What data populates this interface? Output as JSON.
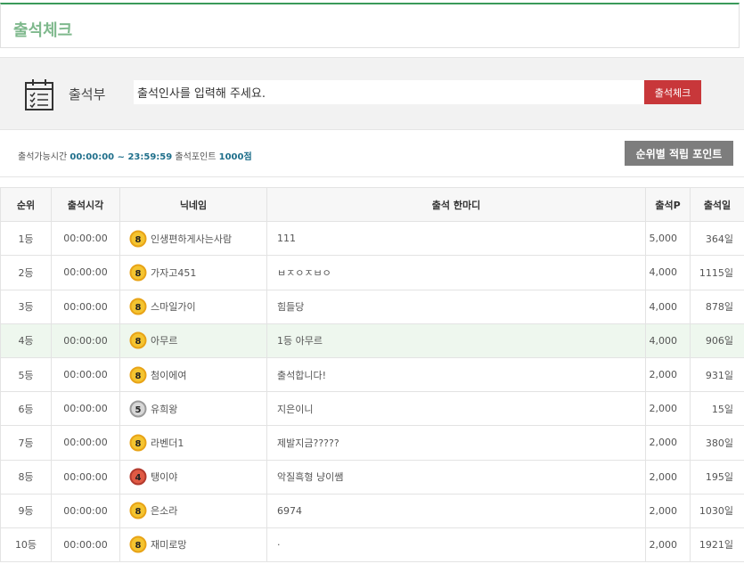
{
  "header": {
    "title": "출석체크"
  },
  "checkin": {
    "book_label": "출석부",
    "input_value": "출석인사를 입력해 주세요.",
    "submit_label": "출석체크"
  },
  "info": {
    "time_label": "출석가능시간",
    "time_value": "00:00:00 ~ 23:59:59",
    "point_label": "출석포인트",
    "point_value": "1000점",
    "rank_button": "순위별 적립 포인트"
  },
  "table": {
    "headers": [
      "순위",
      "출석시각",
      "닉네임",
      "출석 한마디",
      "출석P",
      "출석일"
    ],
    "rows": [
      {
        "rank": "1등",
        "time": "00:00:00",
        "nick": "인생편하게사는사람",
        "level": "8",
        "medal": "gold",
        "msg": "111",
        "points": "5,000",
        "days": "364일"
      },
      {
        "rank": "2등",
        "time": "00:00:00",
        "nick": "가자고451",
        "level": "8",
        "medal": "gold",
        "msg": "ㅂㅈㅇㅈㅂㅇ",
        "points": "4,000",
        "days": "1115일"
      },
      {
        "rank": "3등",
        "time": "00:00:00",
        "nick": "스마일가이",
        "level": "8",
        "medal": "gold",
        "msg": "힘들당",
        "points": "4,000",
        "days": "878일"
      },
      {
        "rank": "4등",
        "time": "00:00:00",
        "nick": "아무르",
        "level": "8",
        "medal": "gold",
        "msg": "1등 아무르",
        "points": "4,000",
        "days": "906일"
      },
      {
        "rank": "5등",
        "time": "00:00:00",
        "nick": "첨이에여",
        "level": "8",
        "medal": "gold",
        "msg": "출석합니다!",
        "points": "2,000",
        "days": "931일"
      },
      {
        "rank": "6등",
        "time": "00:00:00",
        "nick": "유희왕",
        "level": "5",
        "medal": "silver",
        "msg": "지은이니",
        "points": "2,000",
        "days": "15일"
      },
      {
        "rank": "7등",
        "time": "00:00:00",
        "nick": "라벤더1",
        "level": "8",
        "medal": "gold",
        "msg": "제발지금?????",
        "points": "2,000",
        "days": "380일"
      },
      {
        "rank": "8등",
        "time": "00:00:00",
        "nick": "탱이야",
        "level": "4",
        "medal": "red",
        "msg": "악질흑형 냥이쌤",
        "points": "2,000",
        "days": "195일"
      },
      {
        "rank": "9등",
        "time": "00:00:00",
        "nick": "은소라",
        "level": "8",
        "medal": "gold",
        "msg": "6974",
        "points": "2,000",
        "days": "1030일"
      },
      {
        "rank": "10등",
        "time": "00:00:00",
        "nick": "재미로망",
        "level": "8",
        "medal": "gold",
        "msg": "·",
        "points": "2,000",
        "days": "1921일"
      }
    ]
  },
  "colors": {
    "accent_green": "#3a9a5a",
    "button_red": "#c8373a",
    "button_gray": "#7d7d7d",
    "highlight_row": "#eef7ee"
  },
  "highlighted_row_index": 3
}
